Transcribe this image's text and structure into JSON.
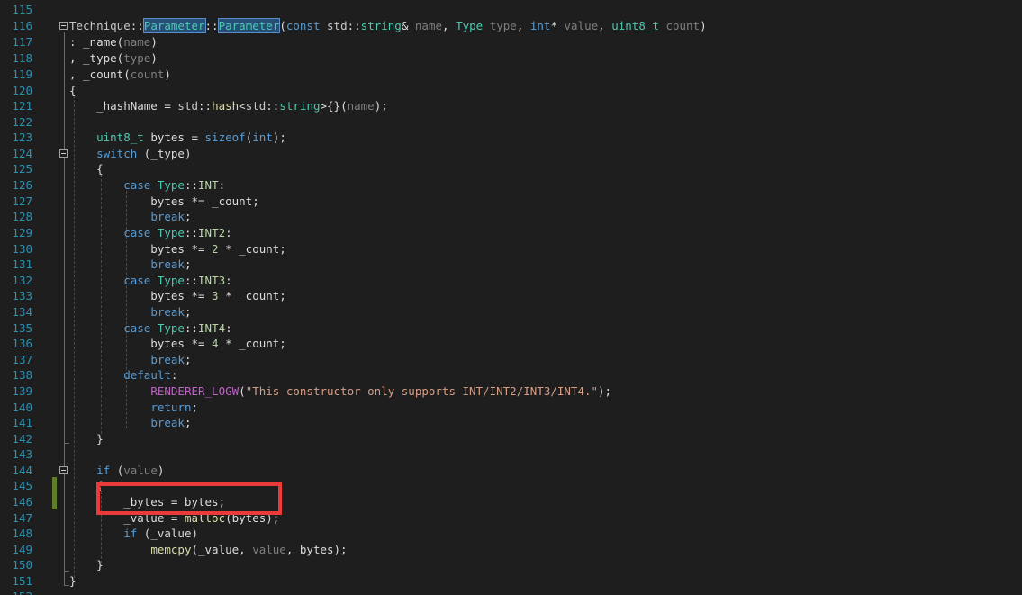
{
  "editor": {
    "lines": [
      {
        "num": "115",
        "code": ""
      },
      {
        "num": "116",
        "code": "Technique::Parameter::Parameter(const std::string& name, Type type, int* value, uint8_t count)"
      },
      {
        "num": "117",
        "code": ": _name(name)"
      },
      {
        "num": "118",
        "code": ", _type(type)"
      },
      {
        "num": "119",
        "code": ", _count(count)"
      },
      {
        "num": "120",
        "code": "{"
      },
      {
        "num": "121",
        "code": "    _hashName = std::hash<std::string>{}(name);"
      },
      {
        "num": "122",
        "code": ""
      },
      {
        "num": "123",
        "code": "    uint8_t bytes = sizeof(int);"
      },
      {
        "num": "124",
        "code": "    switch (_type)"
      },
      {
        "num": "125",
        "code": "    {"
      },
      {
        "num": "126",
        "code": "        case Type::INT:"
      },
      {
        "num": "127",
        "code": "            bytes *= _count;"
      },
      {
        "num": "128",
        "code": "            break;"
      },
      {
        "num": "129",
        "code": "        case Type::INT2:"
      },
      {
        "num": "130",
        "code": "            bytes *= 2 * _count;"
      },
      {
        "num": "131",
        "code": "            break;"
      },
      {
        "num": "132",
        "code": "        case Type::INT3:"
      },
      {
        "num": "133",
        "code": "            bytes *= 3 * _count;"
      },
      {
        "num": "134",
        "code": "            break;"
      },
      {
        "num": "135",
        "code": "        case Type::INT4:"
      },
      {
        "num": "136",
        "code": "            bytes *= 4 * _count;"
      },
      {
        "num": "137",
        "code": "            break;"
      },
      {
        "num": "138",
        "code": "        default:"
      },
      {
        "num": "139",
        "code": "            RENDERER_LOGW(\"This constructor only supports INT/INT2/INT3/INT4.\");"
      },
      {
        "num": "140",
        "code": "            return;"
      },
      {
        "num": "141",
        "code": "            break;"
      },
      {
        "num": "142",
        "code": "    }"
      },
      {
        "num": "143",
        "code": ""
      },
      {
        "num": "144",
        "code": "    if (value)"
      },
      {
        "num": "145",
        "code": "    {"
      },
      {
        "num": "146",
        "code": "        _bytes = bytes;"
      },
      {
        "num": "147",
        "code": "        _value = malloc(bytes);"
      },
      {
        "num": "148",
        "code": "        if (_value)"
      },
      {
        "num": "149",
        "code": "            memcpy(_value, value, bytes);"
      },
      {
        "num": "150",
        "code": "    }"
      },
      {
        "num": "151",
        "code": "}"
      },
      {
        "num": "152",
        "code": ""
      }
    ]
  },
  "colors": {
    "background": "#1e1e1e",
    "line_number": "#2b91af",
    "keyword": "#569cd6",
    "type": "#4ec9b0",
    "parameter": "#7f7f7f",
    "function": "#dcdcaa",
    "macro": "#bd63c5",
    "string": "#d69d85",
    "highlight_box": "#ea3a3a",
    "change_bar": "#5f7d2a"
  },
  "icons": {
    "fold": "collapse-minus-icon"
  }
}
